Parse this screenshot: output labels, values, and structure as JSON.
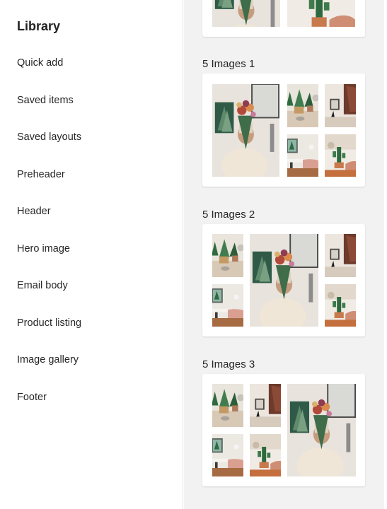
{
  "sidebar": {
    "title": "Library",
    "items": [
      {
        "label": "Quick add"
      },
      {
        "label": "Saved items"
      },
      {
        "label": "Saved layouts"
      },
      {
        "label": "Preheader"
      },
      {
        "label": "Header"
      },
      {
        "label": "Hero image"
      },
      {
        "label": "Email body"
      },
      {
        "label": "Product listing"
      },
      {
        "label": "Image gallery"
      },
      {
        "label": "Footer"
      }
    ]
  },
  "gallery": {
    "sections": [
      {
        "title": "5 Images 1"
      },
      {
        "title": "5 Images 2"
      },
      {
        "title": "5 Images 3"
      }
    ]
  }
}
